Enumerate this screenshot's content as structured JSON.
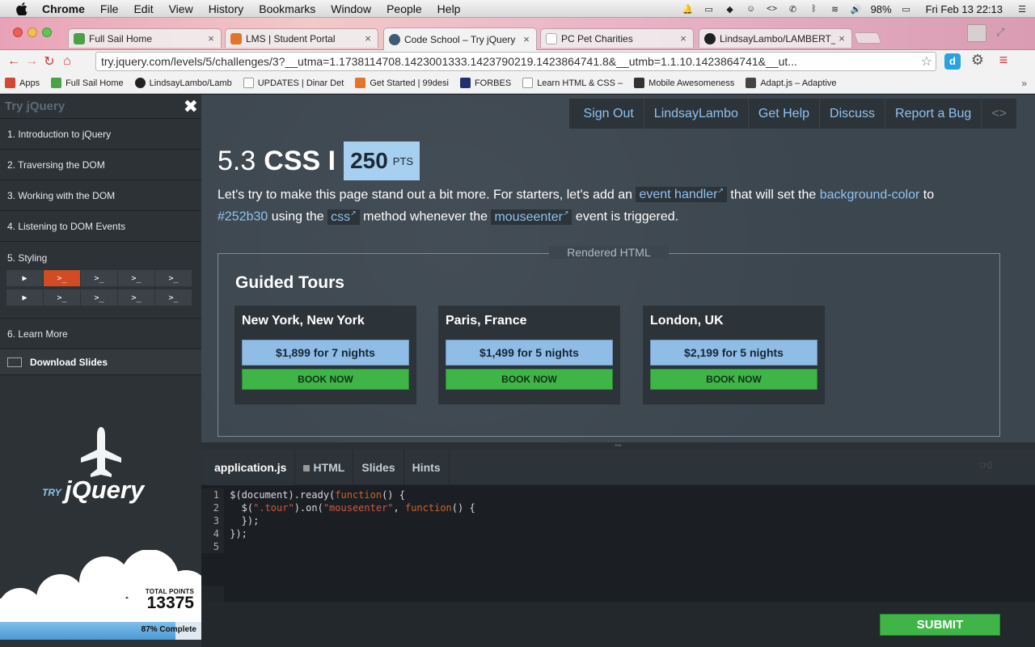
{
  "menubar": {
    "app": "Chrome",
    "items": [
      "File",
      "Edit",
      "View",
      "History",
      "Bookmarks",
      "Window",
      "People",
      "Help"
    ],
    "battery": "98%",
    "datetime": "Fri Feb 13  22:13"
  },
  "tabs": [
    {
      "title": "Full Sail Home",
      "color": "#4aa146"
    },
    {
      "title": "LMS | Student Portal",
      "color": "#e2742c"
    },
    {
      "title": "Code School – Try jQuery",
      "color": "#3d5a77"
    },
    {
      "title": "PC Pet Charities",
      "color": "#cccccc"
    },
    {
      "title": "LindsayLambo/LAMBERT_L",
      "color": "#222222"
    }
  ],
  "omnibox": {
    "url": "try.jquery.com/levels/5/challenges/3?__utma=1.1738114708.1423001333.1423790219.1423864741.8&__utmb=1.1.10.1423864741&__ut..."
  },
  "bookmarks": [
    {
      "label": "Apps",
      "color": "#d14836"
    },
    {
      "label": "Full Sail Home",
      "color": "#4aa146"
    },
    {
      "label": "LindsayLambo/Lamb",
      "color": "#222222"
    },
    {
      "label": "UPDATES | Dinar Det",
      "color": "#dddddd"
    },
    {
      "label": "Get Started | 99desi",
      "color": "#e2742c"
    },
    {
      "label": "FORBES",
      "color": "#22306e"
    },
    {
      "label": "Learn HTML & CSS –",
      "color": "#dddddd"
    },
    {
      "label": "Mobile Awesomeness",
      "color": "#333333"
    },
    {
      "label": "Adapt.js – Adaptive",
      "color": "#444444"
    }
  ],
  "sidebar": {
    "title": "Try jQuery",
    "close": "✖",
    "levels": [
      {
        "label": "1. Introduction to jQuery"
      },
      {
        "label": "2. Traversing the DOM"
      },
      {
        "label": "3. Working with the DOM"
      },
      {
        "label": "4. Listening to DOM Events"
      },
      {
        "label": "5. Styling"
      },
      {
        "label": "6. Learn More"
      }
    ],
    "challenges_row1": [
      "▶",
      ">_",
      ">_",
      ">_",
      ">_"
    ],
    "challenges_row2": [
      "▶",
      ">_",
      ">_",
      ">_",
      ">_"
    ],
    "download": "Download Slides",
    "logo_try": "TRY",
    "logo_jquery": "jQuery",
    "total_points_label": "TOTAL POINTS",
    "total_points": "13375",
    "progress_text": "87% Complete",
    "progress": 0.87
  },
  "topnav": [
    "Sign Out",
    "LindsayLambo",
    "Get Help",
    "Discuss",
    "Report a Bug"
  ],
  "challenge": {
    "number": "5.3",
    "name": "CSS I",
    "points": "250",
    "points_unit": "PTS",
    "desc": {
      "t1": "Let's try to make this page stand out a bit more. For starters, let's add an ",
      "event_handler": "event handler",
      "t2": " that will set the ",
      "bg_color": "background-color",
      "t3": " to",
      "color_value": "#252b30",
      "t4": " using the ",
      "css": "css",
      "t5": " method whenever the ",
      "mouseenter": "mouseenter",
      "t6": " event is triggered."
    }
  },
  "rendered": {
    "label": "Rendered HTML",
    "heading": "Guided Tours",
    "book_label": "BOOK NOW",
    "tours": [
      {
        "name": "New York, New York",
        "price": "$1,899 for 7 nights"
      },
      {
        "name": "Paris, France",
        "price": "$1,499 for 5 nights"
      },
      {
        "name": "London, UK",
        "price": "$2,199 for 5 nights"
      }
    ]
  },
  "editor": {
    "tabs": [
      "application.js",
      "HTML",
      "Slides",
      "Hints"
    ],
    "submit": "SUBMIT"
  }
}
